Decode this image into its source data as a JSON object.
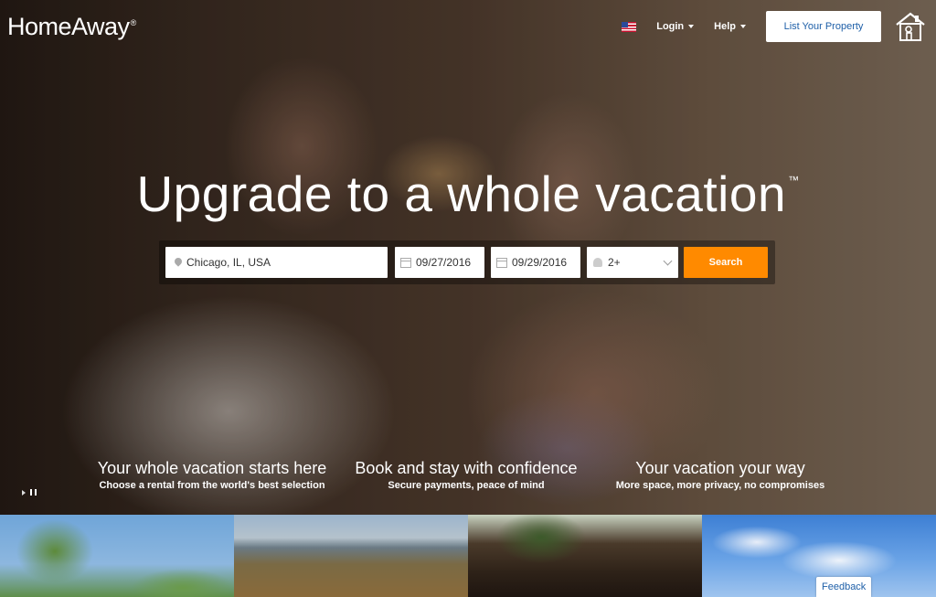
{
  "brand": {
    "name": "HomeAway",
    "reg": "®"
  },
  "nav": {
    "login": "Login",
    "help": "Help",
    "list_property": "List Your Property"
  },
  "hero": {
    "headline": "Upgrade to a whole vacation",
    "tm": "™"
  },
  "search": {
    "location": "Chicago, IL, USA",
    "check_in": "09/27/2016",
    "check_out": "09/29/2016",
    "guests": "2+",
    "button": "Search"
  },
  "features": [
    {
      "title": "Your whole vacation starts here",
      "subtitle": "Choose a rental from the world's best selection"
    },
    {
      "title": "Book and stay with confidence",
      "subtitle": "Secure payments, peace of mind"
    },
    {
      "title": "Your vacation your way",
      "subtitle": "More space, more privacy, no compromises"
    }
  ],
  "feedback": "Feedback",
  "colors": {
    "accent": "#ff8a00",
    "link_blue": "#1e5fa8"
  },
  "icons": [
    "us-flag-icon",
    "house-icon",
    "map-pin-icon",
    "calendar-icon",
    "guests-icon",
    "chevron-down-icon",
    "play-pause-icon"
  ]
}
